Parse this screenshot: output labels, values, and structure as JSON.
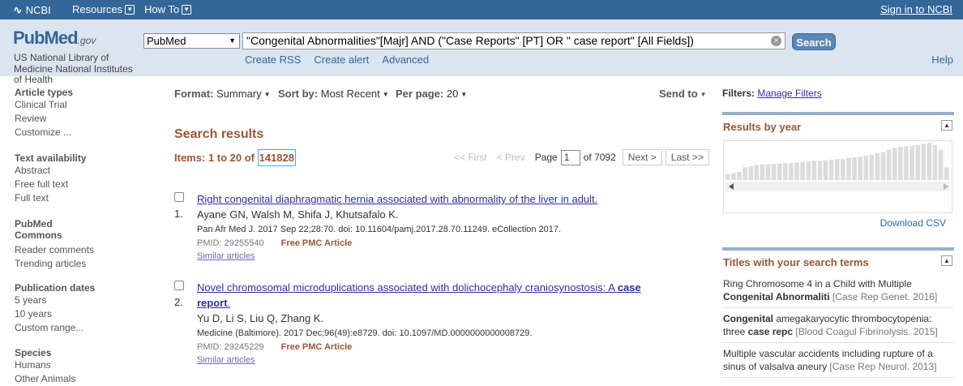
{
  "topbar": {
    "logo": "NCBI",
    "menu": [
      {
        "label": "Resources"
      },
      {
        "label": "How To"
      }
    ],
    "signin": "Sign in to NCBI"
  },
  "header": {
    "logo_main": "PubMed",
    "logo_suffix": ".gov",
    "nlm_text": "US National Library of Medicine National Institutes",
    "nlm_tail": "of Health",
    "db_selected": "PubMed",
    "search_query": "\"Congenital Abnormalities\"[Majr] AND (\"Case Reports\" [PT] OR \" case report\" [All Fields])",
    "search_button": "Search",
    "sublinks": [
      "Create RSS",
      "Create alert",
      "Advanced"
    ],
    "help": "Help"
  },
  "sidebar": {
    "facets": [
      {
        "title": "Article types",
        "items": [
          "Clinical Trial",
          "Review",
          "Customize ..."
        ]
      },
      {
        "title": "Text availability",
        "items": [
          "Abstract",
          "Free full text",
          "Full text"
        ]
      },
      {
        "title": "PubMed Commons",
        "items": [
          "Reader comments",
          "Trending articles"
        ]
      },
      {
        "title": "Publication dates",
        "items": [
          "5 years",
          "10 years",
          "Custom range..."
        ]
      },
      {
        "title": "Species",
        "items": [
          "Humans",
          "Other Animals"
        ]
      }
    ]
  },
  "toolbar": {
    "format_label": "Format:",
    "format_value": "Summary",
    "sort_label": "Sort by:",
    "sort_value": "Most Recent",
    "perpage_label": "Per page:",
    "perpage_value": "20",
    "send_to": "Send to"
  },
  "results": {
    "heading": "Search results",
    "items_prefix": "Items: 1 to 20 of",
    "count": "141828",
    "pager": {
      "first": "<< First",
      "prev": "< Prev",
      "page_label": "Page",
      "page": "1",
      "of": "of 7092",
      "next": "Next >",
      "last": "Last >>"
    },
    "list": [
      {
        "num": "1.",
        "title": "Right congenital diaphragmatic hernia associated with abnormality of the liver in adult.",
        "authors": "Ayane GN, Walsh M, Shifa J, Khutsafalo K.",
        "citation": "Pan Afr Med J. 2017 Sep 22;28:70. doi: 10.11604/pamj.2017.28.70.11249. eCollection 2017.",
        "pmid": "PMID: 29255540",
        "free": "Free PMC Article",
        "similar": "Similar articles"
      },
      {
        "num": "2.",
        "title_part1": "Novel chromosomal microduplications associated with dolichocephaly craniosynostosis: A ",
        "title_bold1": "case",
        "title_bold2": "report",
        "title_end": ".",
        "authors": "Yu D, Li S, Liu Q, Zhang K.",
        "citation": "Medicine (Baltimore). 2017 Dec;96(49):e8729. doi: 10.1097/MD.0000000000008729.",
        "pmid": "PMID: 29245229",
        "free": "Free PMC Article",
        "similar": "Similar articles"
      }
    ]
  },
  "right": {
    "filters_label": "Filters:",
    "manage_filters": "Manage Filters",
    "by_year_title": "Results by year",
    "download_csv": "Download CSV",
    "titles_title": "Titles with your search terms",
    "titles": [
      {
        "l1": "Ring Chromosome 4 in a Child with Multiple",
        "l2_bold": "Congenital Abnormaliti",
        "l2_src": " [Case Rep Genet. 2016]"
      },
      {
        "l1_bold": "Congenital",
        "l1": " amegakaryocytic thrombocytopenia:",
        "l2": "three ",
        "l2_bold": "case repc",
        "l2_src": " [Blood Coagul Fibrinolysis. 2015]"
      },
      {
        "l1": "Multiple vascular accidents including rupture of a",
        "l2": "sinus of valsalva aneury",
        "l2_src": " [Case Rep Neurol. 2013]"
      }
    ]
  },
  "chart_data": {
    "type": "bar",
    "values": [
      10,
      12,
      14,
      22,
      24,
      26,
      27,
      27,
      28,
      28,
      29,
      29,
      30,
      31,
      32,
      33,
      33,
      34,
      35,
      36,
      36,
      38,
      39,
      40,
      42,
      43,
      46,
      48,
      52,
      55,
      57,
      58,
      59,
      60,
      62,
      64,
      60,
      52,
      22
    ]
  }
}
